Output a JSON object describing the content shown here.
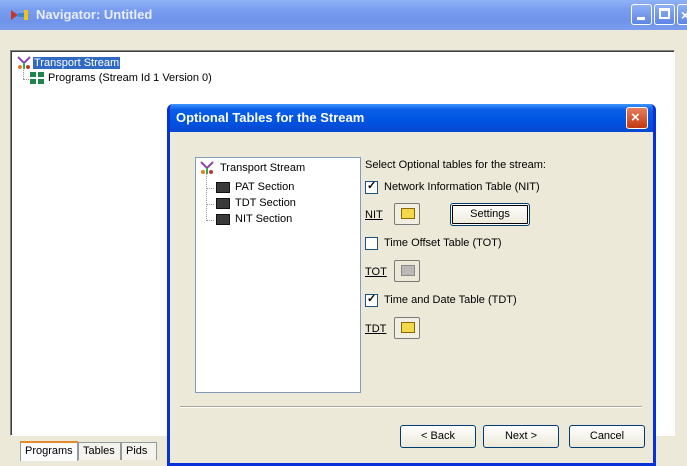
{
  "window": {
    "title": "Navigator: Untitled",
    "tree": {
      "root": "Transport Stream",
      "child": "Programs (Stream Id 1 Version 0)"
    },
    "tabs": [
      "Programs",
      "Tables",
      "Pids"
    ]
  },
  "dialog": {
    "title": "Optional Tables for the Stream",
    "tree": {
      "root": "Transport Stream",
      "items": [
        "PAT Section",
        "TDT Section",
        "NIT Section"
      ]
    },
    "instruction": "Select Optional tables for the stream:",
    "nit": {
      "checkbox_label": "Network Information Table (NIT)",
      "checked": true,
      "field_label": "NIT",
      "settings_label": "Settings"
    },
    "tot": {
      "checkbox_label": "Time Offset Table (TOT)",
      "checked": false,
      "field_label": "TOT"
    },
    "tdt": {
      "checkbox_label": "Time and Date Table (TDT)",
      "checked": true,
      "field_label": "TDT"
    },
    "buttons": {
      "back": "< Back",
      "next": "Next >",
      "cancel": "Cancel"
    }
  },
  "colors": {
    "title_bar_inactive": "#7a9ff0",
    "dialog_title_active": "#0054e3",
    "selection": "#316ac5"
  },
  "icons": {
    "app": "navigator-app-icon",
    "stream": "transport-stream-icon",
    "programs": "programs-icon",
    "section": "section-icon",
    "folder": "folder-icon",
    "cursor": "mouse-pointer-icon"
  }
}
